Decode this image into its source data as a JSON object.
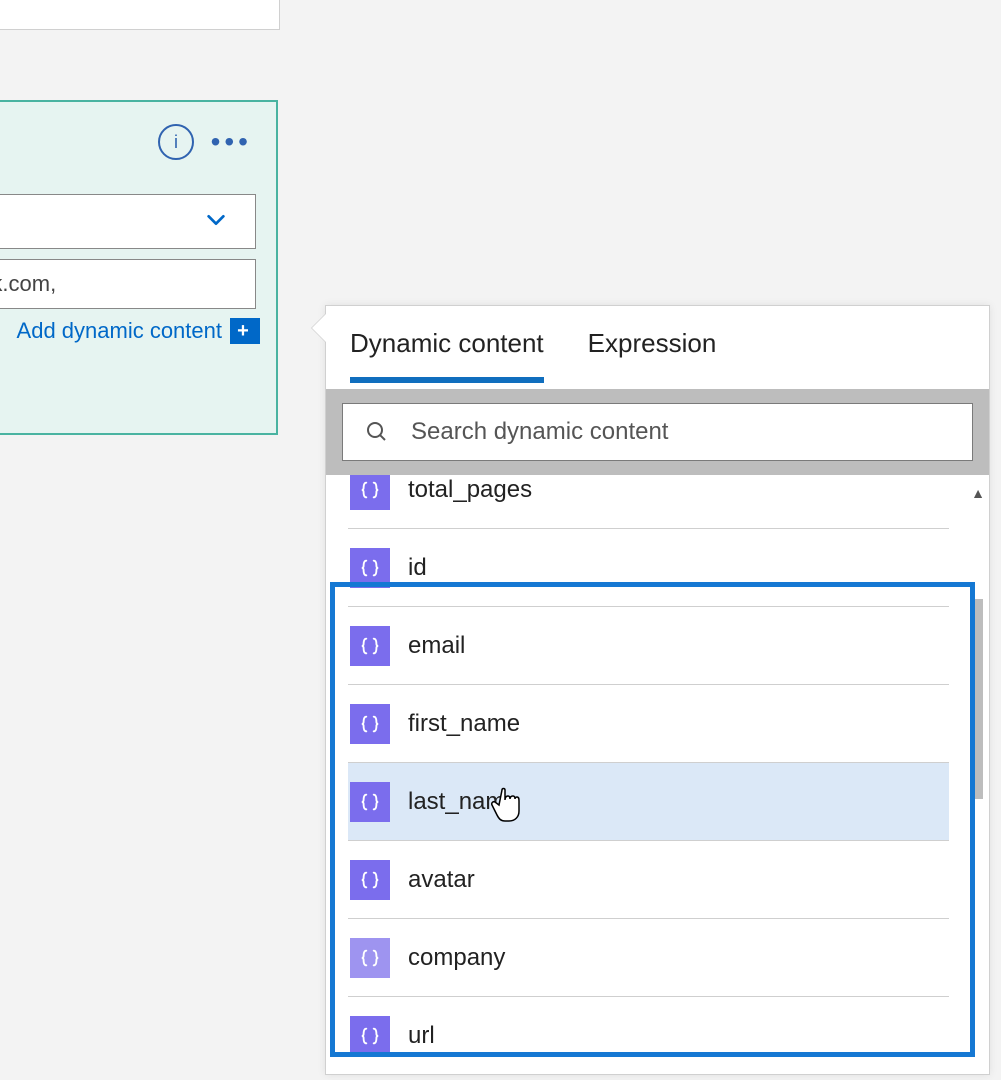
{
  "action_card": {
    "text_field_value": ", see https://api.slack.com,",
    "add_dynamic_label": "Add dynamic content"
  },
  "flyout": {
    "tabs": {
      "dynamic": "Dynamic content",
      "expression": "Expression"
    },
    "search_placeholder": "Search dynamic content",
    "items": [
      {
        "label": "total_pages"
      },
      {
        "label": "id"
      },
      {
        "label": "email"
      },
      {
        "label": "first_name"
      },
      {
        "label": "last_name",
        "hovered": true
      },
      {
        "label": "avatar"
      },
      {
        "label": "company",
        "faded": true
      },
      {
        "label": "url"
      }
    ]
  }
}
